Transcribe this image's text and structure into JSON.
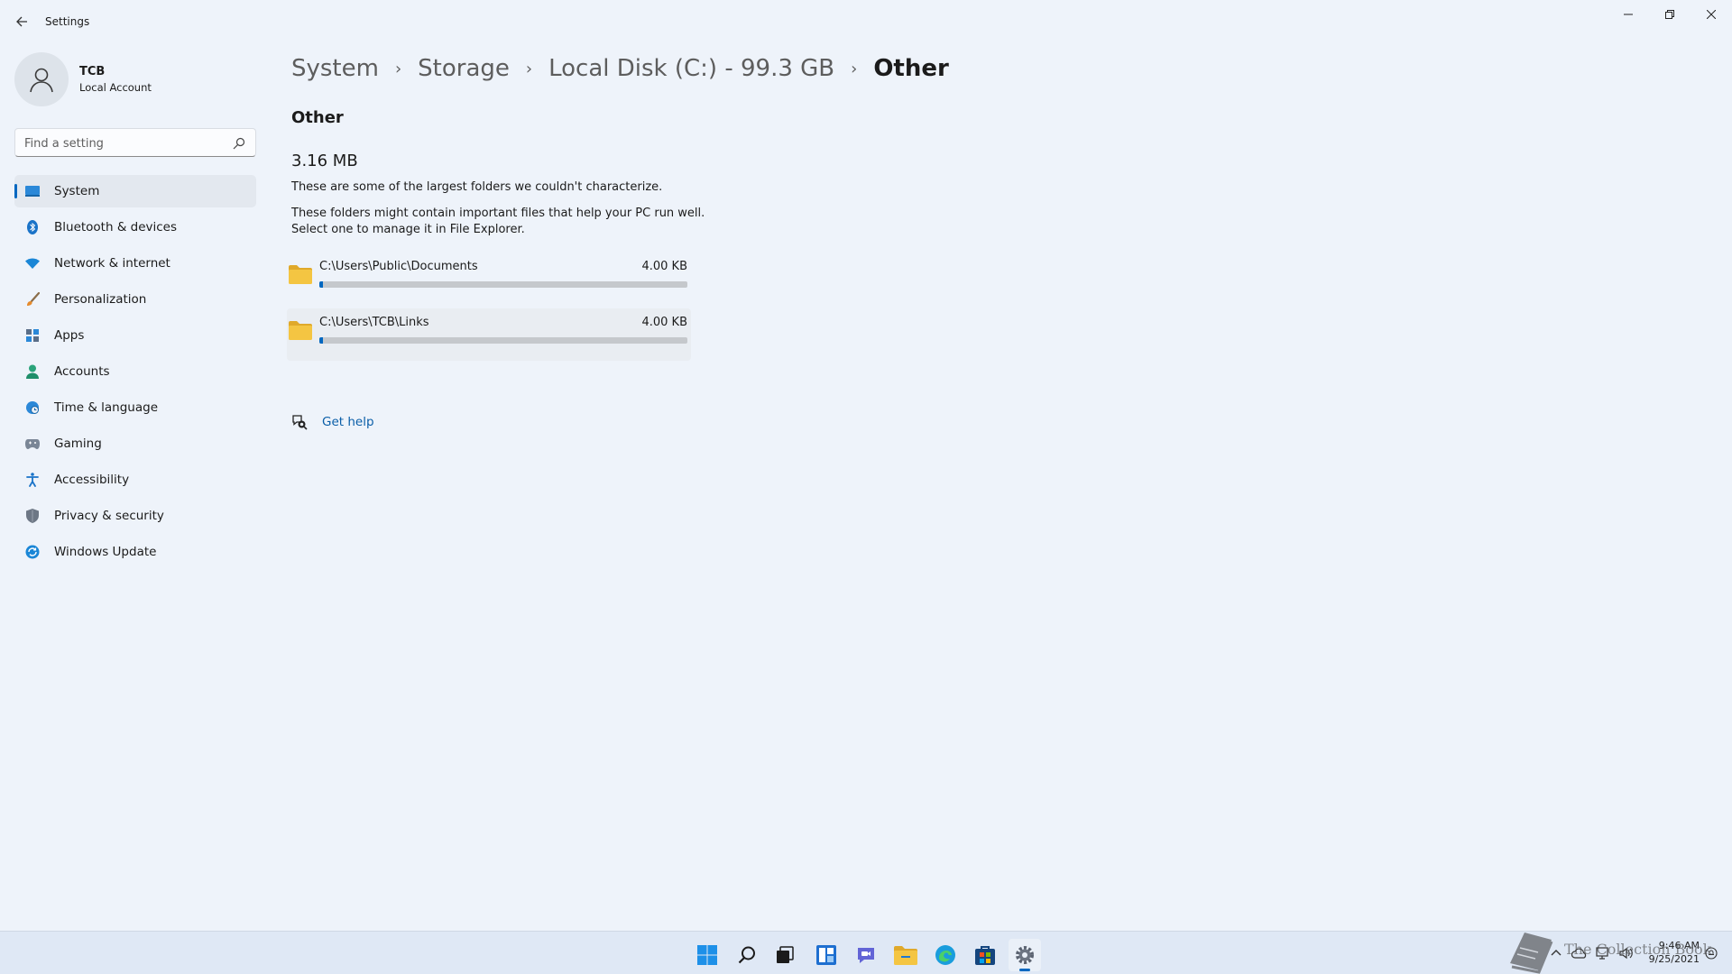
{
  "window": {
    "app_title": "Settings"
  },
  "profile": {
    "name": "TCB",
    "account_type": "Local Account"
  },
  "search": {
    "placeholder": "Find a setting"
  },
  "sidebar": {
    "items": [
      {
        "label": "System",
        "icon": "system-icon",
        "active": true
      },
      {
        "label": "Bluetooth & devices",
        "icon": "bluetooth-icon"
      },
      {
        "label": "Network & internet",
        "icon": "wifi-icon"
      },
      {
        "label": "Personalization",
        "icon": "brush-icon"
      },
      {
        "label": "Apps",
        "icon": "apps-icon"
      },
      {
        "label": "Accounts",
        "icon": "person-icon"
      },
      {
        "label": "Time & language",
        "icon": "globe-clock-icon"
      },
      {
        "label": "Gaming",
        "icon": "gamepad-icon"
      },
      {
        "label": "Accessibility",
        "icon": "accessibility-icon"
      },
      {
        "label": "Privacy & security",
        "icon": "shield-icon"
      },
      {
        "label": "Windows Update",
        "icon": "update-icon"
      }
    ]
  },
  "breadcrumb": {
    "items": [
      "System",
      "Storage",
      "Local Disk (C:) - 99.3 GB",
      "Other"
    ],
    "separator": "›"
  },
  "content": {
    "section_title": "Other",
    "total_size": "3.16 MB",
    "description_1": "These are some of the largest folders we couldn't characterize.",
    "description_2_line1": "These folders might contain important files that help your PC run well.",
    "description_2_line2": "Select one to manage it in File Explorer.",
    "folders": [
      {
        "path": "C:\\Users\\Public\\Documents",
        "size": "4.00 KB",
        "usage_fraction": 0.01
      },
      {
        "path": "C:\\Users\\TCB\\Links",
        "size": "4.00 KB",
        "usage_fraction": 0.01
      }
    ],
    "help_label": "Get help"
  },
  "taskbar": {
    "apps": [
      "start-icon",
      "search-icon",
      "task-view-icon",
      "widgets-icon",
      "chat-icon",
      "file-explorer-icon",
      "edge-icon",
      "store-icon",
      "settings-icon"
    ],
    "clock_time": "9:46 AM",
    "clock_date": "9/25/2021"
  },
  "watermark": {
    "text": "The Collection Book"
  },
  "colors": {
    "accent": "#0067c0",
    "background": "#eef3fa",
    "folder_yellow": "#f4c542"
  }
}
